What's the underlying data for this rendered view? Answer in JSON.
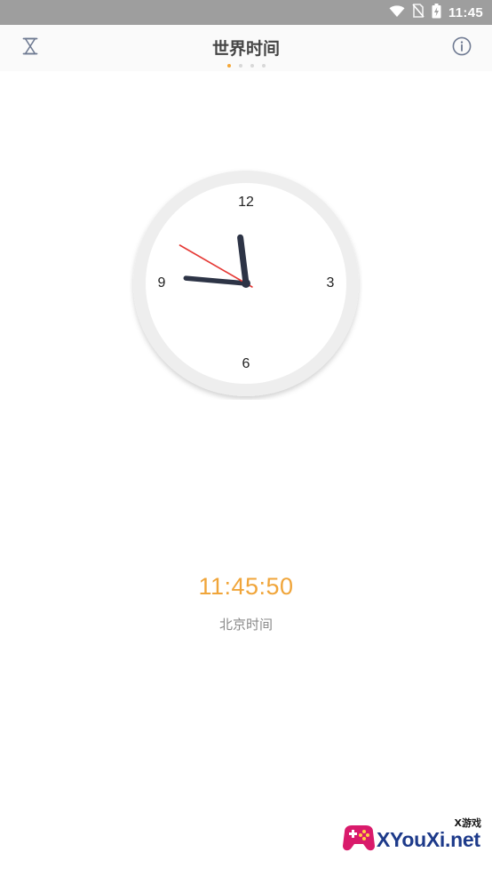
{
  "status_bar": {
    "time": "11:45",
    "icons": [
      "wifi-icon",
      "no-sim-icon",
      "battery-charging-icon"
    ]
  },
  "header": {
    "title": "世界时间",
    "left_icon": "hourglass-icon",
    "right_icon": "info-icon",
    "page_count": 4,
    "active_page": 1
  },
  "clock": {
    "numerals": {
      "twelve": "12",
      "three": "3",
      "six": "6",
      "nine": "9"
    },
    "hours": 11,
    "minutes": 45,
    "seconds": 50,
    "colors": {
      "hands": "#2d3446",
      "second_hand": "#e53935",
      "face": "#ffffff",
      "rim": "#eeeeee"
    }
  },
  "digital": {
    "time": "11:45:50",
    "city": "北京时间",
    "accent": "#f0a53a"
  },
  "watermark": {
    "text": "XYouXi.net",
    "tag": "X游戏"
  }
}
